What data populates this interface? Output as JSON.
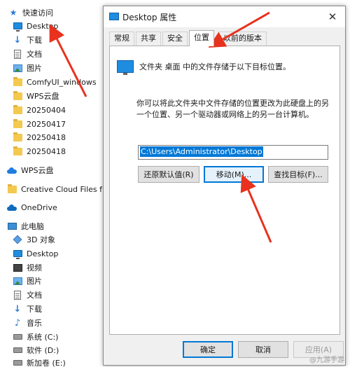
{
  "nav": {
    "items": [
      {
        "label": "快速访问",
        "icon": "star-icon"
      },
      {
        "label": "Desktop",
        "icon": "desktop-icon"
      },
      {
        "label": "下载",
        "icon": "download-icon"
      },
      {
        "label": "文档",
        "icon": "document-icon"
      },
      {
        "label": "图片",
        "icon": "picture-icon"
      },
      {
        "label": "ComfyUI_windows",
        "icon": "folder-icon"
      },
      {
        "label": "WPS云盘",
        "icon": "folder-icon"
      },
      {
        "label": "20250404",
        "icon": "folder-icon"
      },
      {
        "label": "20250417",
        "icon": "folder-icon"
      },
      {
        "label": "20250418",
        "icon": "folder-icon"
      },
      {
        "label": "20250418",
        "icon": "folder-icon"
      },
      {
        "label": "WPS云盘",
        "icon": "cloud-icon"
      },
      {
        "label": "Creative Cloud Files  frim",
        "icon": "folder-icon"
      },
      {
        "label": "OneDrive",
        "icon": "onedrive-icon"
      },
      {
        "label": "此电脑",
        "icon": "computer-icon"
      },
      {
        "label": "3D 对象",
        "icon": "3d-objects-icon"
      },
      {
        "label": "Desktop",
        "icon": "desktop-icon"
      },
      {
        "label": "视频",
        "icon": "video-icon"
      },
      {
        "label": "图片",
        "icon": "picture-icon"
      },
      {
        "label": "文档",
        "icon": "document-icon"
      },
      {
        "label": "下载",
        "icon": "download-icon"
      },
      {
        "label": "音乐",
        "icon": "music-icon"
      },
      {
        "label": "系统 (C:)",
        "icon": "drive-icon"
      },
      {
        "label": "软件 (D:)",
        "icon": "drive-icon"
      },
      {
        "label": "新加卷 (E:)",
        "icon": "drive-icon"
      }
    ]
  },
  "dialog": {
    "title": "Desktop 属性",
    "tabs": [
      "常规",
      "共享",
      "安全",
      "位置",
      "以前的版本"
    ],
    "active_tab": "位置",
    "info_text": "文件夹 桌面 中的文件存储于以下目标位置。",
    "description": "你可以将此文件夹中文件存储的位置更改为此硬盘上的另一个位置、另一个驱动器或网络上的另一台计算机。",
    "path_value": "C:\\Users\\Administrator\\Desktop",
    "buttons": {
      "restore_default": "还原默认值(R)",
      "move": "移动(M)...",
      "find_target": "查找目标(F)..."
    },
    "footer": {
      "ok": "确定",
      "cancel": "取消",
      "apply": "应用(A)"
    }
  },
  "watermark": "@九游手游",
  "colors": {
    "accent": "#0078d7",
    "arrow": "#e8321e",
    "folder": "#f3c94f"
  }
}
